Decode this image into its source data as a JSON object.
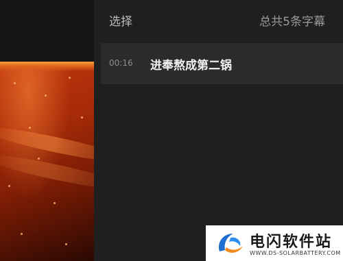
{
  "header": {
    "select_label": "选择",
    "total_label": "总共5条字幕"
  },
  "subtitles": [
    {
      "time": "00:16",
      "text": "进奉熬成第二锅"
    }
  ],
  "watermark": {
    "logo_icon": "blue-orange-swoosh-logo-icon",
    "title": "电闪软件站",
    "url": "WWW.DS-SOLARBATTERY.COM"
  },
  "colors": {
    "panel_bg": "#1f1f1f",
    "row_bg": "#2b2b2b",
    "video_accent": "#c2370c"
  }
}
